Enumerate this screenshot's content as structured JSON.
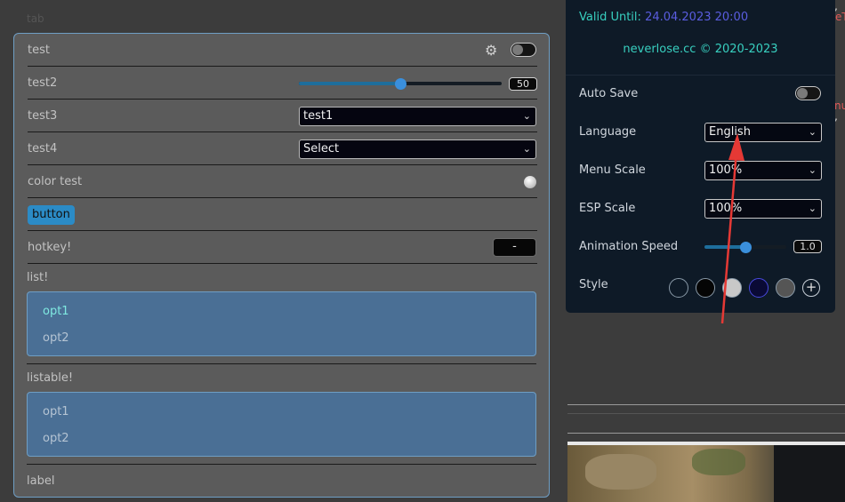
{
  "background": {
    "faded_label": "tab"
  },
  "left_panel": {
    "rows": {
      "test": {
        "label": "test"
      },
      "test2": {
        "label": "test2",
        "value": 50,
        "value_text": "50"
      },
      "test3": {
        "label": "test3",
        "selected": "test1"
      },
      "test4": {
        "label": "test4",
        "selected": "Select"
      },
      "color_test": {
        "label": "color test"
      },
      "button": {
        "label": "button"
      },
      "hotkey": {
        "label": "hotkey!",
        "value": "-"
      }
    },
    "list": {
      "title": "list!",
      "options": [
        "opt1",
        "opt2"
      ],
      "selected_index": 0
    },
    "listable": {
      "title": "listable!",
      "options": [
        "opt1",
        "opt2"
      ]
    },
    "label": "label"
  },
  "right_panel": {
    "valid_until_label": "Valid Until:",
    "valid_until_value": "24.04.2023 20:00",
    "copyright": "neverlose.cc © 2020-2023",
    "auto_save": {
      "label": "Auto Save"
    },
    "language": {
      "label": "Language",
      "selected": "English"
    },
    "menu_scale": {
      "label": "Menu Scale",
      "selected": "100%"
    },
    "esp_scale": {
      "label": "ESP Scale",
      "selected": "100%"
    },
    "animation_speed": {
      "label": "Animation Speed",
      "value": 1.0,
      "value_text": "1.0"
    },
    "style": {
      "label": "Style",
      "colors": [
        "#0e1a27",
        "#050505",
        "#c8c8c8",
        "#0a0a35",
        "#555555"
      ],
      "add": "+"
    }
  },
  "edge_fragments": {
    "top": ",",
    "middle": "nu",
    "red": "eT"
  },
  "colors": {
    "accent": "#2b8bc6",
    "teal": "#38d0c0",
    "panel_border": "#6f9ec4",
    "list_bg": "#4a6f95",
    "annotation_arrow": "#e53935"
  }
}
